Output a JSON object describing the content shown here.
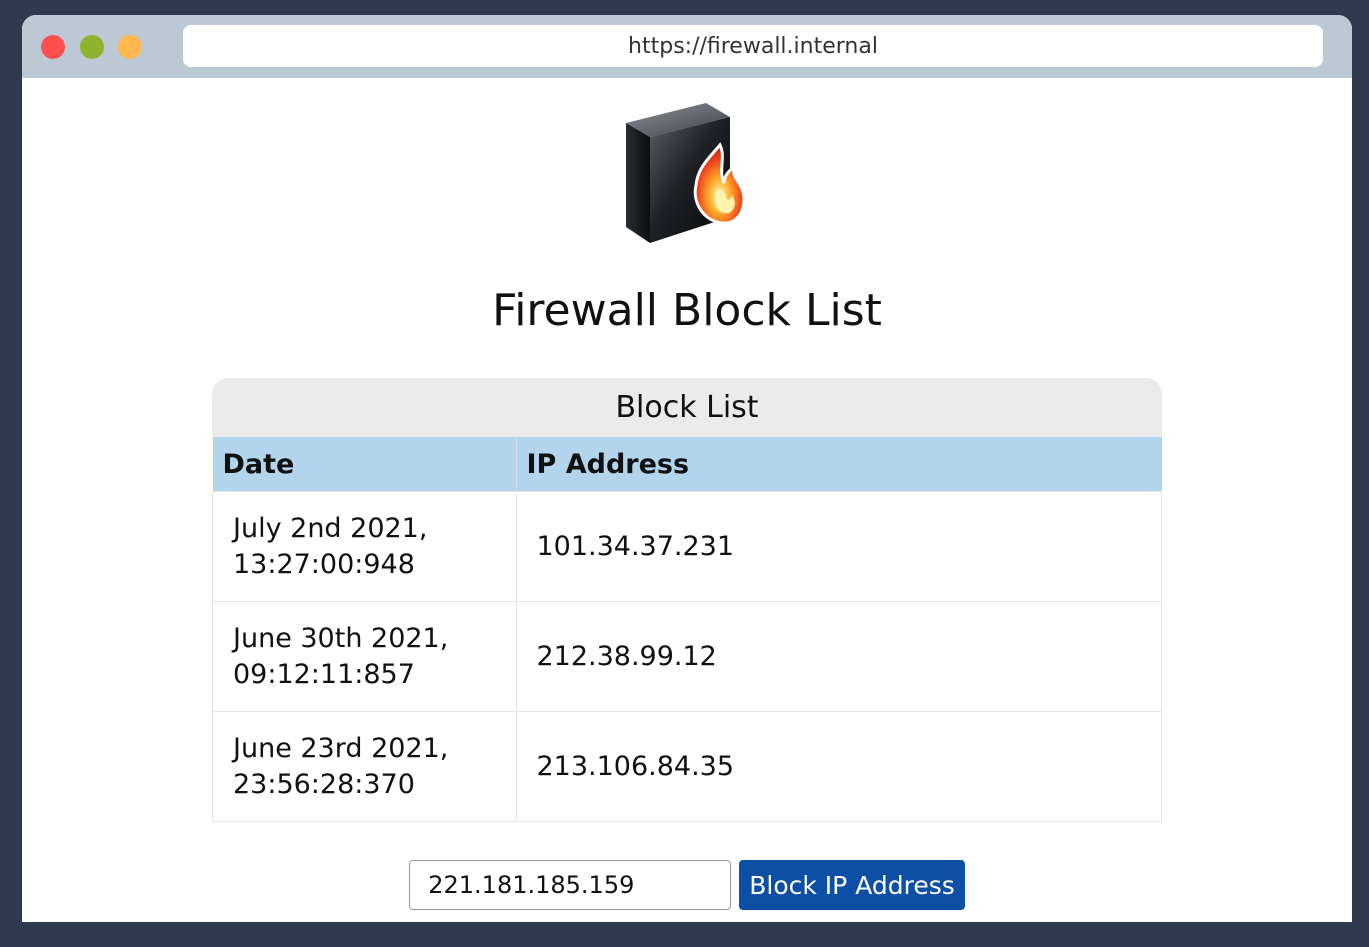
{
  "browser": {
    "url": "https://firewall.internal"
  },
  "page": {
    "title": "Firewall Block List"
  },
  "block_list": {
    "heading": "Block List",
    "columns": [
      "Date",
      "IP Address"
    ],
    "rows": [
      {
        "date": "July 2nd 2021,\n13:27:00:948",
        "ip": "101.34.37.231"
      },
      {
        "date": "June 30th 2021,\n09:12:11:857",
        "ip": "212.38.99.12"
      },
      {
        "date": "June 23rd 2021,\n23:56:28:370",
        "ip": "213.106.84.35"
      }
    ]
  },
  "form": {
    "ip_value": "221.181.185.159",
    "button_label": "Block IP Address"
  },
  "icons": {
    "logo": "firewall-icon"
  },
  "colors": {
    "accent": "#0d4fa5",
    "table_header": "#b2d5ed",
    "titlebar": "#bcc9d4",
    "frame": "#303a4f"
  }
}
